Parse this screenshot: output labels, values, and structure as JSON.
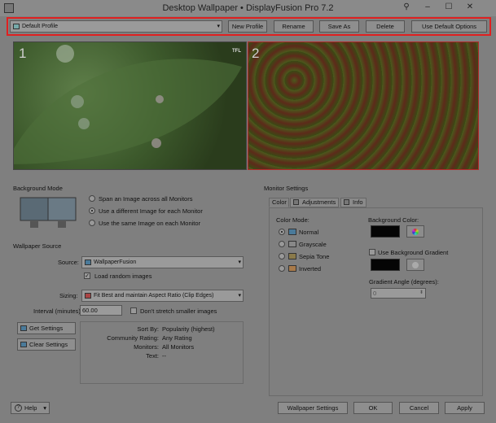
{
  "window": {
    "title": "Desktop Wallpaper • DisplayFusion Pro 7.2"
  },
  "toolbar": {
    "profile": "Default Profile",
    "buttons": [
      "New Profile",
      "Rename",
      "Save As",
      "Delete",
      "Use Default Options"
    ]
  },
  "monitors": [
    {
      "number": "1",
      "badge": "TFL"
    },
    {
      "number": "2"
    }
  ],
  "background_mode": {
    "heading": "Background Mode",
    "options": [
      "Span an Image across all Monitors",
      "Use a different Image for each Monitor",
      "Use the same Image on each Monitor"
    ],
    "selected": 1
  },
  "wallpaper_source": {
    "heading": "Wallpaper Source",
    "source_label": "Source:",
    "source_value": "WallpaperFusion",
    "load_random": "Load random images",
    "load_random_checked": true,
    "sizing_label": "Sizing:",
    "sizing_value": "Fit Best and maintain Aspect Ratio (Clip Edges)",
    "interval_label": "Interval (minutes):",
    "interval_value": "60.00",
    "dont_stretch": "Don't stretch smaller images",
    "dont_stretch_checked": false,
    "get_settings": "Get Settings",
    "clear_settings": "Clear Settings",
    "info": [
      {
        "key": "Sort By:",
        "value": "Popularity (highest)"
      },
      {
        "key": "Community Rating:",
        "value": "Any Rating"
      },
      {
        "key": "Monitors:",
        "value": "All Monitors"
      },
      {
        "key": "Text:",
        "value": "--"
      }
    ]
  },
  "monitor_settings": {
    "heading": "Monitor Settings",
    "tabs": [
      "Color",
      "Adjustments",
      "Info"
    ],
    "color_mode_label": "Color Mode:",
    "color_modes": [
      "Normal",
      "Grayscale",
      "Sepia Tone",
      "Inverted"
    ],
    "selected_mode": 0,
    "bg_color_label": "Background Color:",
    "bg_color": "#050505",
    "use_gradient": "Use Background Gradient",
    "use_gradient_checked": false,
    "gradient_color": "#050505",
    "gradient_angle_label": "Gradient Angle (degrees):",
    "gradient_angle_value": "0"
  },
  "footer": {
    "help": "Help",
    "wallpaper_settings": "Wallpaper Settings",
    "ok": "OK",
    "cancel": "Cancel",
    "apply": "Apply"
  },
  "colors": {
    "highlight_border": "#e02020",
    "dim_overlay": "#7f7f7f"
  }
}
